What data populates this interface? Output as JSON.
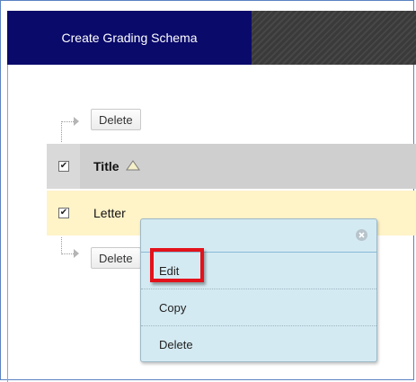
{
  "header": {
    "tab_label": "Create Grading Schema"
  },
  "actions": {
    "top_delete_label": "Delete",
    "bottom_delete_label": "Delete"
  },
  "table": {
    "header": {
      "title_label": "Title",
      "checked": true
    },
    "rows": [
      {
        "title": "Letter",
        "checked": true
      }
    ]
  },
  "context_menu": {
    "items": [
      {
        "label": "Edit"
      },
      {
        "label": "Copy"
      },
      {
        "label": "Delete"
      }
    ]
  },
  "colors": {
    "tab_bg": "#0a0a6b",
    "header_row_bg": "#cfcfcf",
    "selected_row_bg": "#fff3c8",
    "menu_bg": "#d4eaf2",
    "highlight_border": "#e3121b"
  },
  "icons": {
    "sort": "sort-ascending-icon",
    "close": "close-icon",
    "checkbox": "checkbox-checked"
  }
}
